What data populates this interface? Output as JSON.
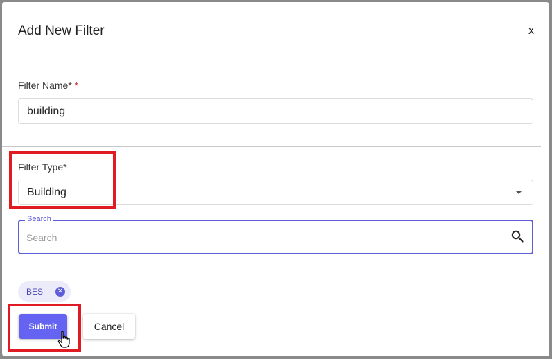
{
  "dialog": {
    "title": "Add New Filter",
    "close_label": "x"
  },
  "filter_name": {
    "label": "Filter Name*",
    "required_mark": "*",
    "value": "building"
  },
  "filter_type": {
    "label": "Filter Type*",
    "value": "Building"
  },
  "search": {
    "legend": "Search",
    "placeholder": "Search"
  },
  "chips": [
    {
      "label": "BES"
    }
  ],
  "actions": {
    "submit_label": "Submit",
    "cancel_label": "Cancel"
  },
  "colors": {
    "accent": "#6463f2",
    "highlight": "#e01b24",
    "required": "#d32f2f"
  }
}
